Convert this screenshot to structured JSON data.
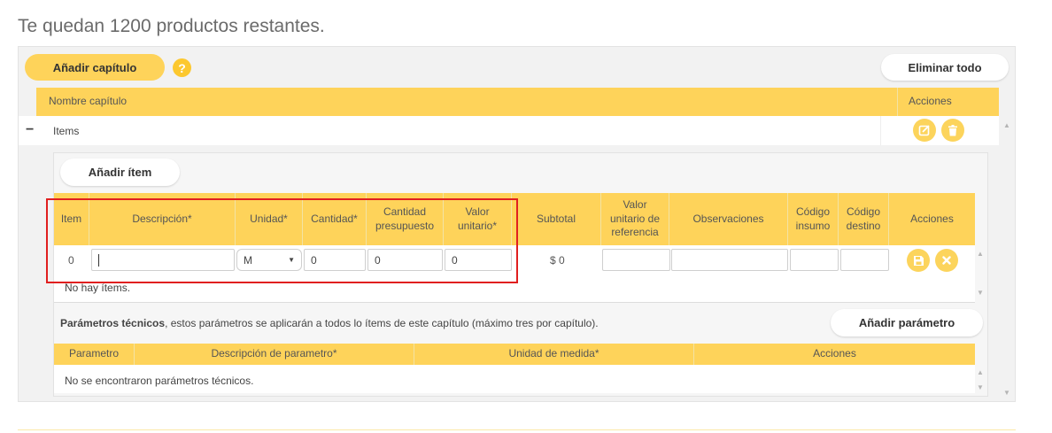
{
  "page": {
    "title": "Te quedan 1200 productos restantes."
  },
  "toolbar": {
    "add_chapter_label": "Añadir capítulo",
    "help_label": "?",
    "delete_all_label": "Eliminar todo"
  },
  "chapters_table": {
    "headers": {
      "name": "Nombre capítulo",
      "actions": "Acciones"
    },
    "row": {
      "toggle": "−",
      "name": "Items"
    }
  },
  "items_section": {
    "add_item_label": "Añadir ítem",
    "headers": {
      "item": "Item",
      "description": "Descripción*",
      "unit": "Unidad*",
      "quantity": "Cantidad*",
      "budget_quantity": "Cantidad presupuesto",
      "unit_value": "Valor unitario*",
      "subtotal": "Subtotal",
      "reference_value": "Valor unitario de referencia",
      "observations": "Observaciones",
      "input_code": "Código insumo",
      "destination_code": "Código destino",
      "actions": "Acciones"
    },
    "row": {
      "index": "0",
      "description": "",
      "unit": "M",
      "quantity": "0",
      "budget_quantity": "0",
      "unit_value": "0",
      "subtotal": "$ 0",
      "reference_value": "",
      "observations": "",
      "input_code": "",
      "destination_code": ""
    },
    "empty_text": "No hay ítems."
  },
  "parameters_section": {
    "intro_bold": "Parámetros técnicos",
    "intro_rest": ", estos parámetros se aplicarán a todos lo ítems de este capítulo (máximo tres por capítulo).",
    "add_parameter_label": "Añadir parámetro",
    "headers": {
      "parameter": "Parametro",
      "description": "Descripción de parametro*",
      "unit": "Unidad de medida*",
      "actions": "Acciones"
    },
    "empty_text": "No se encontraron parámetros técnicos."
  },
  "colors": {
    "accent": "#fed35a",
    "icon_accent": "#fcd45c",
    "highlight": "#e01f1f"
  }
}
